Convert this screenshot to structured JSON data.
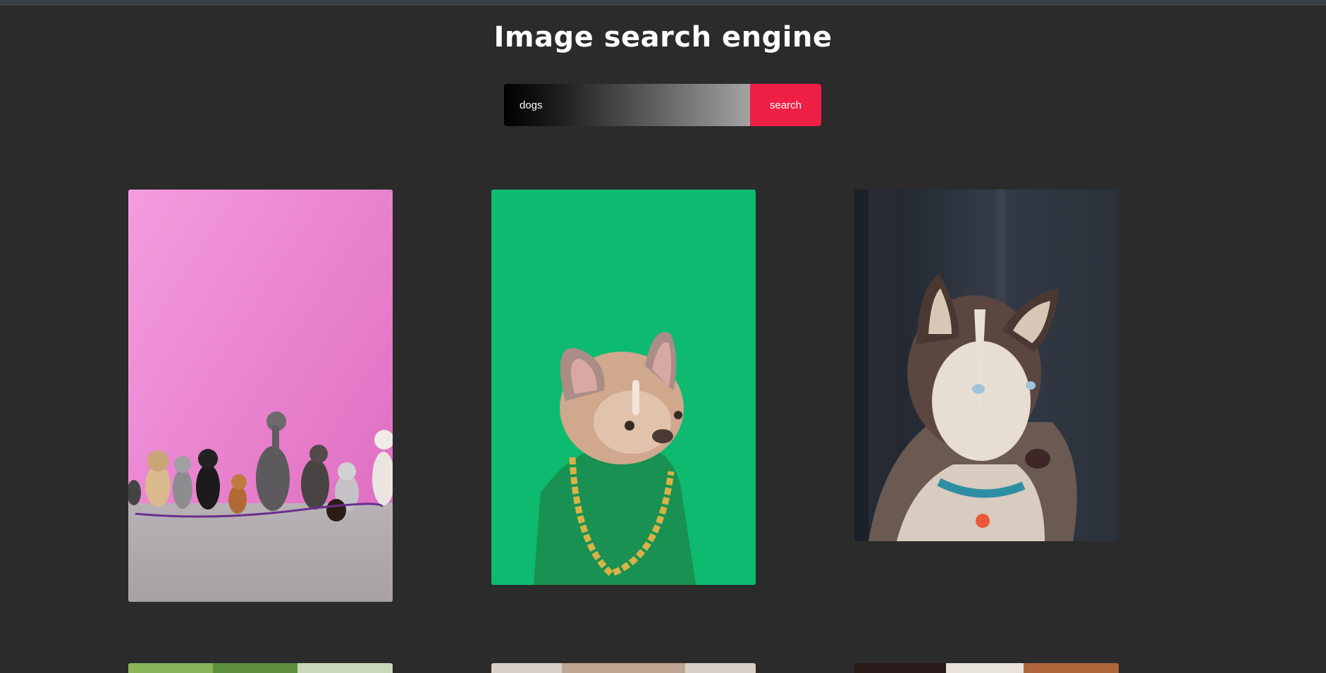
{
  "page": {
    "title": "Image search engine"
  },
  "search": {
    "value": "dogs",
    "button_label": "search"
  },
  "results": [
    {
      "subject": "group of dogs sitting by pink wall",
      "background": "#f17bd3"
    },
    {
      "subject": "french bulldog with gold chain on green background",
      "background": "#0fbf73"
    },
    {
      "subject": "husky portrait",
      "background": "#1f2530"
    },
    {
      "subject": "dog photo (partially visible)",
      "background": "#6a9a4a"
    },
    {
      "subject": "dog photo (partially visible)",
      "background": "#d9cfc7"
    },
    {
      "subject": "dog photo (partially visible)",
      "background": "#2a1a1a"
    }
  ],
  "colors": {
    "background": "#2b2b2b",
    "accent": "#ef1f45",
    "text": "#ffffff"
  }
}
